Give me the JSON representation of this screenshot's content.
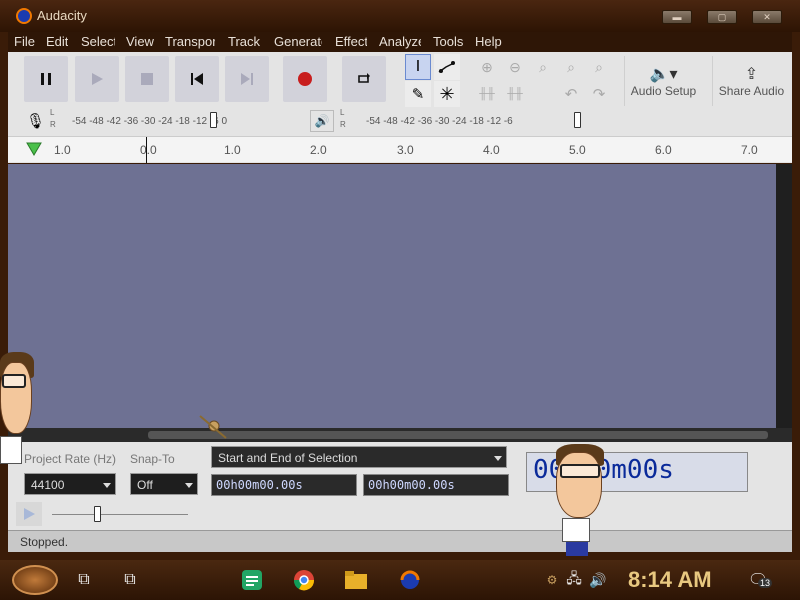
{
  "window": {
    "title": "Audacity",
    "buttons": [
      "minimize",
      "maximize",
      "close"
    ]
  },
  "menu": [
    {
      "label": "File"
    },
    {
      "label": "Edit"
    },
    {
      "label": "Select"
    },
    {
      "label": "View"
    },
    {
      "label": "Transport"
    },
    {
      "label": "Track"
    },
    {
      "label": "Generate"
    },
    {
      "label": "Effect"
    },
    {
      "label": "Analyze"
    },
    {
      "label": "Tools"
    },
    {
      "label": "Help"
    }
  ],
  "toolbar": {
    "transport": [
      "pause-icon",
      "play-icon",
      "stop-icon",
      "skip-start-icon",
      "skip-end-icon",
      "record-icon",
      "loop-icon"
    ],
    "audio_setup_label": "Audio Setup",
    "share_audio_label": "Share Audio"
  },
  "meters": {
    "record_scale": "-54  -48  -42  -36  -30  -24  -18  -12   -6   0",
    "play_scale": "-54  -48  -42  -36  -30  -24  -18  -12   -6",
    "left_label": "L",
    "right_label": "R"
  },
  "timeline": {
    "ticks": [
      "1.0",
      "0.0",
      "1.0",
      "2.0",
      "3.0",
      "4.0",
      "5.0",
      "6.0",
      "7.0"
    ]
  },
  "selection_bar": {
    "project_rate_label": "Project Rate (Hz)",
    "project_rate_value": "44100",
    "snap_to_label": "Snap-To",
    "snap_to_value": "Off",
    "selection_mode": "Start and End of Selection",
    "start_time": "00h00m00.00s",
    "end_time": "00h00m00.00s",
    "big_time": "00h00m00s"
  },
  "status": {
    "text": "Stopped."
  },
  "taskbar": {
    "clock": "8:14 AM",
    "notification_count": "13",
    "colors": {
      "sheets": "#22a565",
      "chrome_red": "#db4437",
      "folder": "#e8b02a"
    }
  }
}
